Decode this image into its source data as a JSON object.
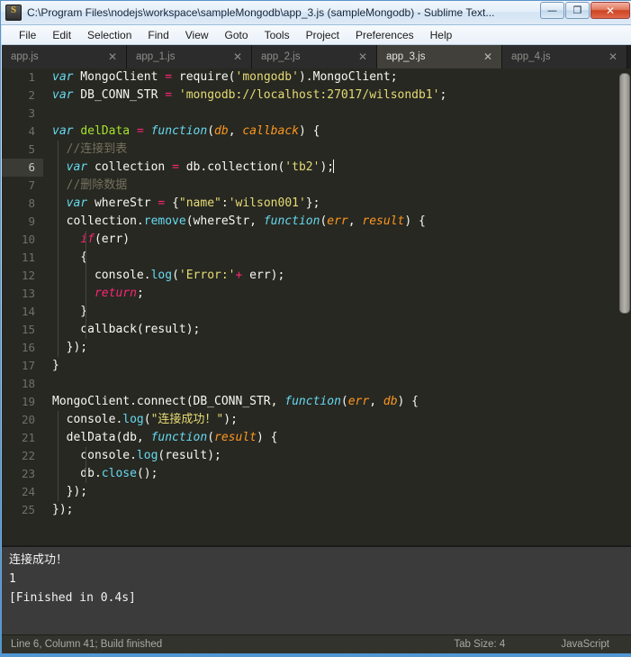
{
  "window": {
    "title": "C:\\Program Files\\nodejs\\workspace\\sampleMongodb\\app_3.js (sampleMongodb) - Sublime Text...",
    "icon": "sublime-text-icon",
    "minimize_glyph": "—",
    "maximize_glyph": "❐",
    "close_glyph": "✕",
    "colors": {
      "titlebar": "#e4eef8",
      "editor_bg": "#272822",
      "console_bg": "#3b3b3b",
      "statusbar_bg": "#32332d",
      "accent_blue": "#4f97d6"
    }
  },
  "menu": {
    "items": [
      {
        "label": "File"
      },
      {
        "label": "Edit"
      },
      {
        "label": "Selection"
      },
      {
        "label": "Find"
      },
      {
        "label": "View"
      },
      {
        "label": "Goto"
      },
      {
        "label": "Tools"
      },
      {
        "label": "Project"
      },
      {
        "label": "Preferences"
      },
      {
        "label": "Help"
      }
    ]
  },
  "tabs": {
    "close_glyph": "✕",
    "items": [
      {
        "label": "app.js",
        "active": false
      },
      {
        "label": "app_1.js",
        "active": false
      },
      {
        "label": "app_2.js",
        "active": false
      },
      {
        "label": "app_3.js",
        "active": true
      },
      {
        "label": "app_4.js",
        "active": false
      }
    ]
  },
  "editor": {
    "language": "JavaScript",
    "cursor_line": 6,
    "line_numbers": [
      "1",
      "2",
      "3",
      "4",
      "5",
      "6",
      "7",
      "8",
      "9",
      "10",
      "11",
      "12",
      "13",
      "14",
      "15",
      "16",
      "17",
      "18",
      "19",
      "20",
      "21",
      "22",
      "23",
      "24",
      "25"
    ],
    "lines": [
      "var MongoClient = require('mongodb').MongoClient;",
      "var DB_CONN_STR = 'mongodb://localhost:27017/wilsondb1';",
      "",
      "var delData = function(db, callback) {",
      "  //连接到表",
      "  var collection = db.collection('tb2');",
      "  //删除数据",
      "  var whereStr = {\"name\":'wilson001'};",
      "  collection.remove(whereStr, function(err, result) {",
      "    if(err)",
      "    {",
      "      console.log('Error:'+ err);",
      "      return;",
      "    }",
      "    callback(result);",
      "  });",
      "}",
      "",
      "MongoClient.connect(DB_CONN_STR, function(err, db) {",
      "  console.log(\"连接成功！\");",
      "  delData(db, function(result) {",
      "    console.log(result);",
      "    db.close();",
      "  });",
      "});"
    ]
  },
  "console_panel": {
    "lines": [
      "连接成功！",
      "1",
      "[Finished in 0.4s]"
    ]
  },
  "statusbar": {
    "left": "Line 6, Column 41; Build finished",
    "tab_size": "Tab Size: 4",
    "language": "JavaScript"
  }
}
